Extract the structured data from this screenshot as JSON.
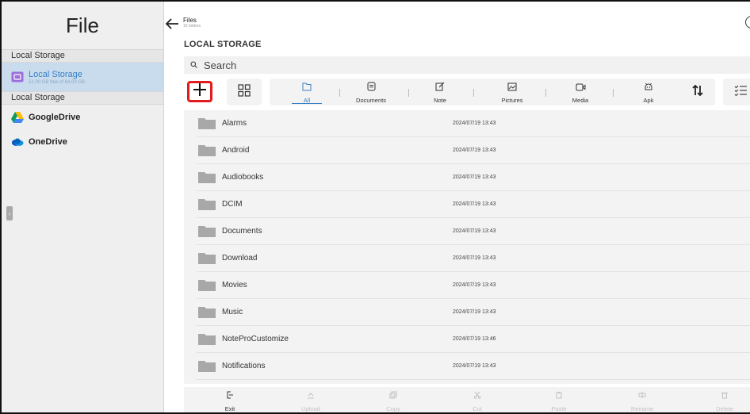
{
  "sidebar": {
    "title": "File",
    "section_local": "Local Storage",
    "active_item": {
      "label": "Local Storage",
      "sub": "51.00 GB free of 64.00 GB"
    },
    "section_local_2": "Local Storage",
    "clouds": [
      {
        "label": "GoogleDrive",
        "icon": "google-drive-icon"
      },
      {
        "label": "OneDrive",
        "icon": "onedrive-icon"
      }
    ]
  },
  "header": {
    "breadcrumb_title": "Files",
    "breadcrumb_sub": "15 folders",
    "storage_title": "LOCAL STORAGE"
  },
  "search": {
    "placeholder": "Search"
  },
  "filters": [
    {
      "label": "All",
      "icon": "folder-outline-icon",
      "active": true
    },
    {
      "label": "Documents",
      "icon": "document-icon",
      "active": false
    },
    {
      "label": "Note",
      "icon": "note-icon",
      "active": false
    },
    {
      "label": "Pictures",
      "icon": "picture-icon",
      "active": false
    },
    {
      "label": "Media",
      "icon": "media-icon",
      "active": false
    },
    {
      "label": "Apk",
      "icon": "android-icon",
      "active": false
    }
  ],
  "files": [
    {
      "name": "Alarms",
      "date": "2024/07/19 13:43"
    },
    {
      "name": "Android",
      "date": "2024/07/19 13:43"
    },
    {
      "name": "Audiobooks",
      "date": "2024/07/19 13:43"
    },
    {
      "name": "DCIM",
      "date": "2024/07/19 13:43"
    },
    {
      "name": "Documents",
      "date": "2024/07/19 13:43"
    },
    {
      "name": "Download",
      "date": "2024/07/19 13:43"
    },
    {
      "name": "Movies",
      "date": "2024/07/19 13:43"
    },
    {
      "name": "Music",
      "date": "2024/07/19 13:43"
    },
    {
      "name": "NoteProCustomize",
      "date": "2024/07/19 13:46"
    },
    {
      "name": "Notifications",
      "date": "2024/07/19 13:43"
    }
  ],
  "actions": [
    {
      "label": "Exit",
      "icon": "exit-icon",
      "enabled": true
    },
    {
      "label": "Upload",
      "icon": "upload-icon",
      "enabled": false
    },
    {
      "label": "Copy",
      "icon": "copy-icon",
      "enabled": false
    },
    {
      "label": "Cut",
      "icon": "cut-icon",
      "enabled": false
    },
    {
      "label": "Paste",
      "icon": "paste-icon",
      "enabled": false
    },
    {
      "label": "Rename",
      "icon": "rename-icon",
      "enabled": false
    },
    {
      "label": "Delete",
      "icon": "delete-icon",
      "enabled": false
    }
  ],
  "colors": {
    "accent": "#3a7fc4",
    "highlight": "#e01c1c",
    "folder": "#a8a8a8",
    "sidebar_active": "#c9dced"
  }
}
